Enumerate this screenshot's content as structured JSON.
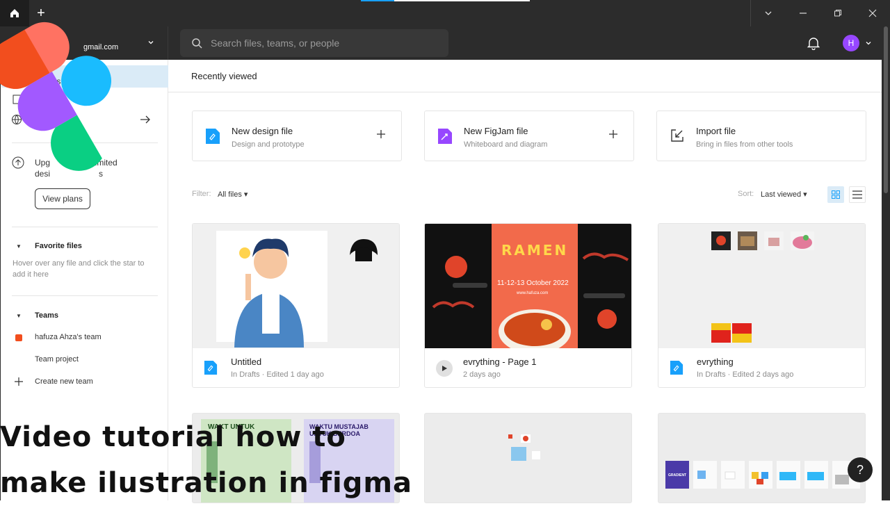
{
  "titlebar": {
    "new_tab": "+"
  },
  "header": {
    "account_email": "gmail.com",
    "search_placeholder": "Search files, teams, or people",
    "avatar_initial": "H"
  },
  "sidebar": {
    "recents_label": "ts",
    "upgrade_text": "Upg... limited desi... s",
    "upgrade_line1": "Upg",
    "upgrade_line1b": "limited",
    "upgrade_line2": "desi",
    "upgrade_line2b": "s",
    "view_plans": "View plans",
    "favorites_title": "Favorite files",
    "favorites_hint": "Hover over any file and click the star to add it here",
    "teams_title": "Teams",
    "team_name": "hafuza Ahza's team",
    "team_project": "Team project",
    "create_team": "Create new team"
  },
  "main": {
    "title": "Recently viewed",
    "actions": [
      {
        "title": "New design file",
        "subtitle": "Design and prototype"
      },
      {
        "title": "New FigJam file",
        "subtitle": "Whiteboard and diagram"
      },
      {
        "title": "Import file",
        "subtitle": "Bring in files from other tools"
      }
    ],
    "filter_label": "Filter:",
    "filter_value": "All files ▾",
    "sort_label": "Sort:",
    "sort_value": "Last viewed ▾",
    "files": [
      {
        "title": "Untitled",
        "subtitle": "In Drafts · Edited 1 day ago"
      },
      {
        "title": "evrything - Page 1",
        "subtitle": "2 days ago"
      },
      {
        "title": "evrything",
        "subtitle": "In Drafts · Edited 2 days ago"
      }
    ],
    "ramen_title": "RAMEN",
    "ramen_date": "11-12-13 October 2022",
    "ramen_url": "www.hafuza.com",
    "poster_a_top": "WAKT UNTUK",
    "poster_b_top": "WAKTU MUSTAJAB UNTUK BERDOA",
    "gradient_label": "GRADIENT"
  },
  "overlay": {
    "caption_line1": "Video tutorial how to",
    "caption_line2": "make ilustration in figma",
    "help": "?"
  },
  "colors": {
    "accent": "#18a0fb",
    "team": "#f24e1e",
    "avatar": "#9747ff"
  }
}
